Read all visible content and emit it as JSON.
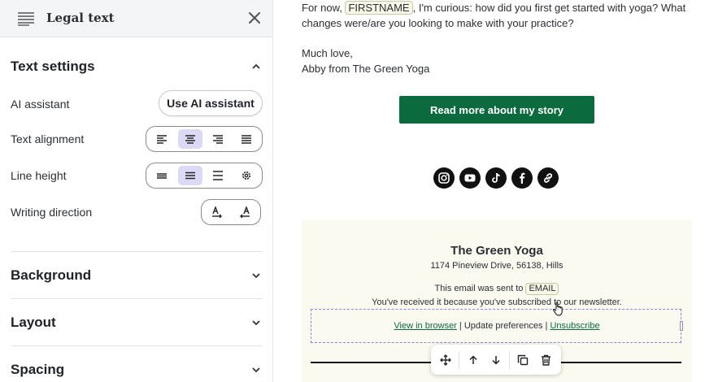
{
  "panel": {
    "title": "Legal text",
    "block_icon": "text-lines-icon",
    "close_icon": "close-icon",
    "text_settings": {
      "title": "Text settings",
      "expanded": true,
      "ai_assistant": {
        "label": "AI assistant",
        "button": "Use AI assistant"
      },
      "text_alignment": {
        "label": "Text alignment",
        "options": [
          "align-left-icon",
          "align-center-icon",
          "align-right-icon",
          "align-justify-icon"
        ],
        "selected": 1
      },
      "line_height": {
        "label": "Line height",
        "options": [
          "line-height-compact-icon",
          "line-height-normal-icon",
          "line-height-loose-icon",
          "settings-gear-icon"
        ],
        "selected": 1
      },
      "writing_direction": {
        "label": "Writing direction",
        "options": [
          "ltr-direction-icon",
          "rtl-direction-icon"
        ]
      }
    },
    "sections": [
      {
        "title": "Background",
        "expanded": false
      },
      {
        "title": "Layout",
        "expanded": false
      },
      {
        "title": "Spacing",
        "expanded": false
      }
    ]
  },
  "email": {
    "line1_before": "For now,",
    "merge_firstname": "FIRSTNAME",
    "line1_after": ", I'm curious: how did you first get started with yoga? What",
    "line2": "changes were/are you looking to make with your practice?",
    "signoff": "Much love,",
    "signature": "Abby from The Green Yoga",
    "cta_label": "Read more about my story",
    "socials": [
      "instagram-icon",
      "youtube-icon",
      "tiktok-icon",
      "facebook-icon",
      "link-icon"
    ],
    "footer": {
      "brand": "The Green Yoga",
      "address": "1174 Pineview Drive, 56138, Hills",
      "sent_to": "This email was sent to",
      "merge_email": "EMAIL",
      "reason": "You've received it because you've subscribed to our newsletter.",
      "links": {
        "view": "View in browser",
        "sep1": " | ",
        "update": "Update preferences",
        "sep2": " | ",
        "unsubscribe": "Unsubscribe"
      }
    },
    "toolbar": [
      "move-icon",
      "arrow-up-icon",
      "arrow-down-icon",
      "duplicate-icon",
      "trash-icon"
    ]
  },
  "colors": {
    "accent_purple": "#dcd9f6",
    "cta_green": "#0b6b3f",
    "footer_bg": "#fbfaf1"
  }
}
